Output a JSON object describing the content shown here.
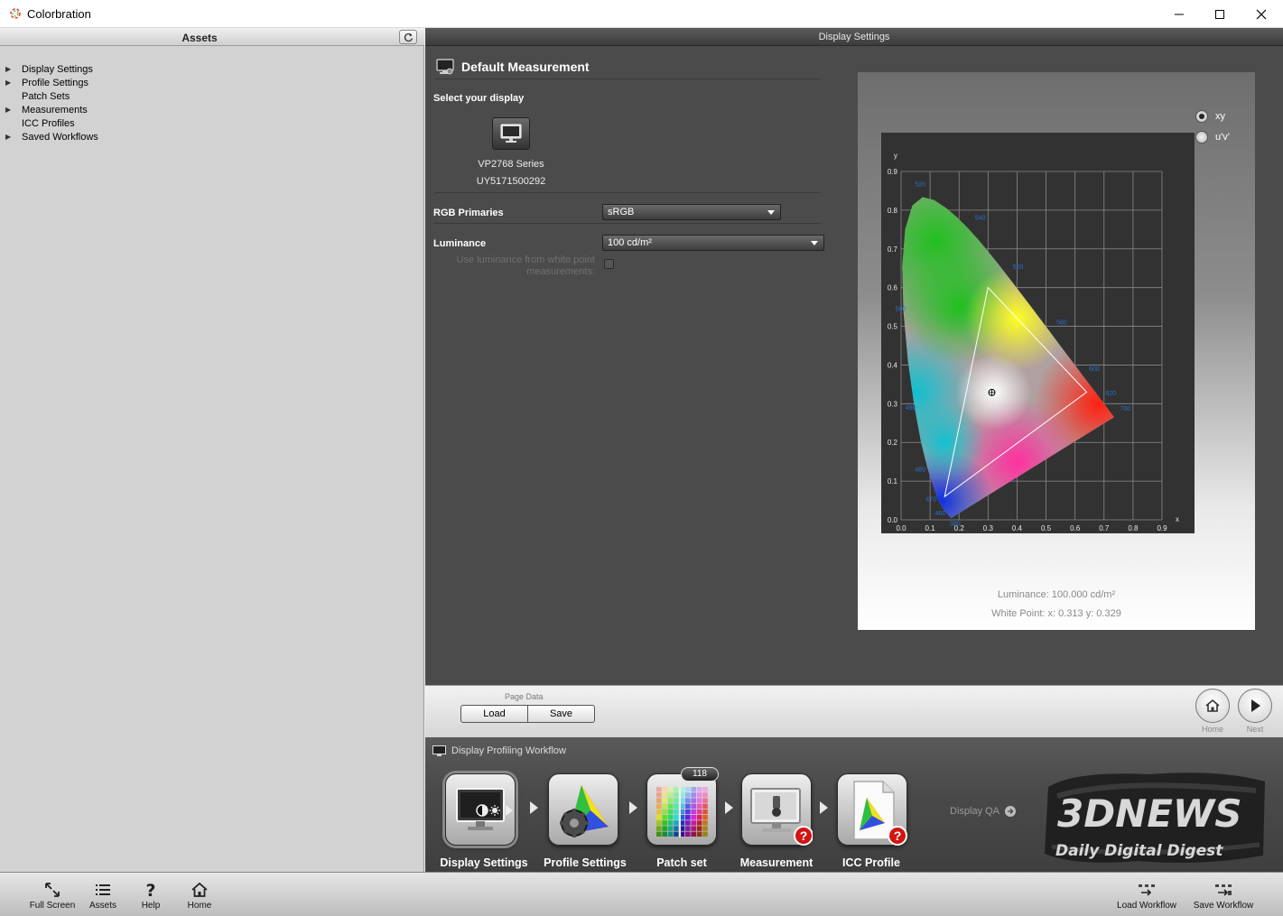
{
  "window": {
    "title": "Colorbration"
  },
  "assets_panel": {
    "header": "Assets",
    "items": [
      {
        "label": "Display Settings",
        "expandable": true
      },
      {
        "label": "Profile Settings",
        "expandable": true
      },
      {
        "label": "Patch Sets",
        "expandable": false
      },
      {
        "label": "Measurements",
        "expandable": true
      },
      {
        "label": "ICC Profiles",
        "expandable": false
      },
      {
        "label": "Saved Workflows",
        "expandable": true
      }
    ]
  },
  "main": {
    "header": "Display Settings",
    "section_title": "Default Measurement",
    "select_display_label": "Select your display",
    "display": {
      "name": "VP2768 Series",
      "serial": "UY5171500292"
    },
    "rgb_primaries": {
      "label": "RGB Primaries",
      "value": "sRGB"
    },
    "luminance": {
      "label": "Luminance",
      "value": "100 cd/m²"
    },
    "use_luminance_line1": "Use luminance from white point",
    "use_luminance_line2": "measurements:"
  },
  "chart_options": {
    "xy_label": "xy",
    "uv_label": "u'v'",
    "selected": "xy"
  },
  "chart_footer": {
    "luminance": "Luminance: 100.000 cd/m²",
    "white_point": "White Point: x: 0.313  y: 0.329"
  },
  "chart_data": {
    "type": "scatter",
    "title": "",
    "xlabel": "x",
    "ylabel": "y",
    "xlim": [
      0,
      0.9
    ],
    "ylim": [
      0,
      0.9
    ],
    "grid": true,
    "x_ticks": [
      "0.0",
      "0.1",
      "0.2",
      "0.3",
      "0.4",
      "0.5",
      "0.6",
      "0.7",
      "0.8",
      "0.9"
    ],
    "y_ticks": [
      "0.0",
      "0.1",
      "0.2",
      "0.3",
      "0.4",
      "0.5",
      "0.6",
      "0.7",
      "0.8",
      "0.9"
    ],
    "spectral_locus": [
      [
        0.1741,
        0.005
      ],
      [
        0.1738,
        0.0049
      ],
      [
        0.1736,
        0.0049
      ],
      [
        0.1726,
        0.0048
      ],
      [
        0.1714,
        0.0051
      ],
      [
        0.1689,
        0.0069
      ],
      [
        0.1644,
        0.0109
      ],
      [
        0.1566,
        0.0177
      ],
      [
        0.144,
        0.0297
      ],
      [
        0.1241,
        0.0578
      ],
      [
        0.0913,
        0.1327
      ],
      [
        0.0687,
        0.2007
      ],
      [
        0.0454,
        0.295
      ],
      [
        0.0235,
        0.4127
      ],
      [
        0.0082,
        0.5384
      ],
      [
        0.0039,
        0.6548
      ],
      [
        0.0139,
        0.7502
      ],
      [
        0.0389,
        0.812
      ],
      [
        0.0743,
        0.8338
      ],
      [
        0.1142,
        0.8262
      ],
      [
        0.1547,
        0.8059
      ],
      [
        0.1929,
        0.7816
      ],
      [
        0.2296,
        0.7543
      ],
      [
        0.2658,
        0.7243
      ],
      [
        0.3016,
        0.6923
      ],
      [
        0.3373,
        0.6589
      ],
      [
        0.3731,
        0.6245
      ],
      [
        0.4087,
        0.5896
      ],
      [
        0.4441,
        0.5547
      ],
      [
        0.4788,
        0.5202
      ],
      [
        0.5125,
        0.4866
      ],
      [
        0.5448,
        0.4544
      ],
      [
        0.5752,
        0.4242
      ],
      [
        0.6029,
        0.3965
      ],
      [
        0.627,
        0.3725
      ],
      [
        0.6482,
        0.3514
      ],
      [
        0.6658,
        0.334
      ],
      [
        0.6801,
        0.3197
      ],
      [
        0.6915,
        0.3083
      ],
      [
        0.7006,
        0.2993
      ],
      [
        0.7079,
        0.292
      ],
      [
        0.714,
        0.2859
      ],
      [
        0.719,
        0.2809
      ],
      [
        0.723,
        0.277
      ],
      [
        0.726,
        0.274
      ],
      [
        0.7283,
        0.2717
      ],
      [
        0.73,
        0.27
      ],
      [
        0.7311,
        0.2689
      ],
      [
        0.732,
        0.268
      ],
      [
        0.7327,
        0.2673
      ],
      [
        0.7334,
        0.2666
      ],
      [
        0.734,
        0.266
      ],
      [
        0.7344,
        0.2656
      ],
      [
        0.7346,
        0.2654
      ],
      [
        0.7347,
        0.2653
      ]
    ],
    "gamut_triangle": [
      [
        0.64,
        0.33
      ],
      [
        0.3,
        0.6
      ],
      [
        0.15,
        0.06
      ]
    ],
    "white_point": [
      0.313,
      0.329
    ],
    "wavelength_labels": [
      {
        "text": "380",
        "x": 0.168,
        "y": -0.015
      },
      {
        "text": "460",
        "x": 0.118,
        "y": 0.012
      },
      {
        "text": "470",
        "x": 0.085,
        "y": 0.048
      },
      {
        "text": "480",
        "x": 0.048,
        "y": 0.125
      },
      {
        "text": "490",
        "x": 0.015,
        "y": 0.285
      },
      {
        "text": "500",
        "x": -0.02,
        "y": 0.54
      },
      {
        "text": "520",
        "x": 0.048,
        "y": 0.862
      },
      {
        "text": "540",
        "x": 0.255,
        "y": 0.775
      },
      {
        "text": "560",
        "x": 0.385,
        "y": 0.648
      },
      {
        "text": "580",
        "x": 0.536,
        "y": 0.505
      },
      {
        "text": "600",
        "x": 0.648,
        "y": 0.385
      },
      {
        "text": "620",
        "x": 0.705,
        "y": 0.322
      },
      {
        "text": "700",
        "x": 0.755,
        "y": 0.282
      }
    ]
  },
  "page_data": {
    "label": "Page Data",
    "load": "Load",
    "save": "Save"
  },
  "nav": {
    "home": "Home",
    "next": "Next"
  },
  "workflow": {
    "title": "Display Profiling Workflow",
    "steps": [
      {
        "label": "Display Settings"
      },
      {
        "label": "Profile Settings"
      },
      {
        "label": "Patch set",
        "badge": "118"
      },
      {
        "label": "Measurement"
      },
      {
        "label": "ICC Profile"
      }
    ],
    "qa_link": "Display QA"
  },
  "watermark": {
    "line1": "3DNEWS",
    "line2": "Daily Digital Digest"
  },
  "toolbar": {
    "full_screen": "Full Screen",
    "assets": "Assets",
    "help": "Help",
    "home": "Home",
    "load_workflow": "Load Workflow",
    "save_workflow": "Save Workflow"
  },
  "colors": {
    "accent_blue": "#1a6fd0",
    "panel_dark": "#4b4b4b",
    "assets_bg": "#d2d2d2"
  }
}
